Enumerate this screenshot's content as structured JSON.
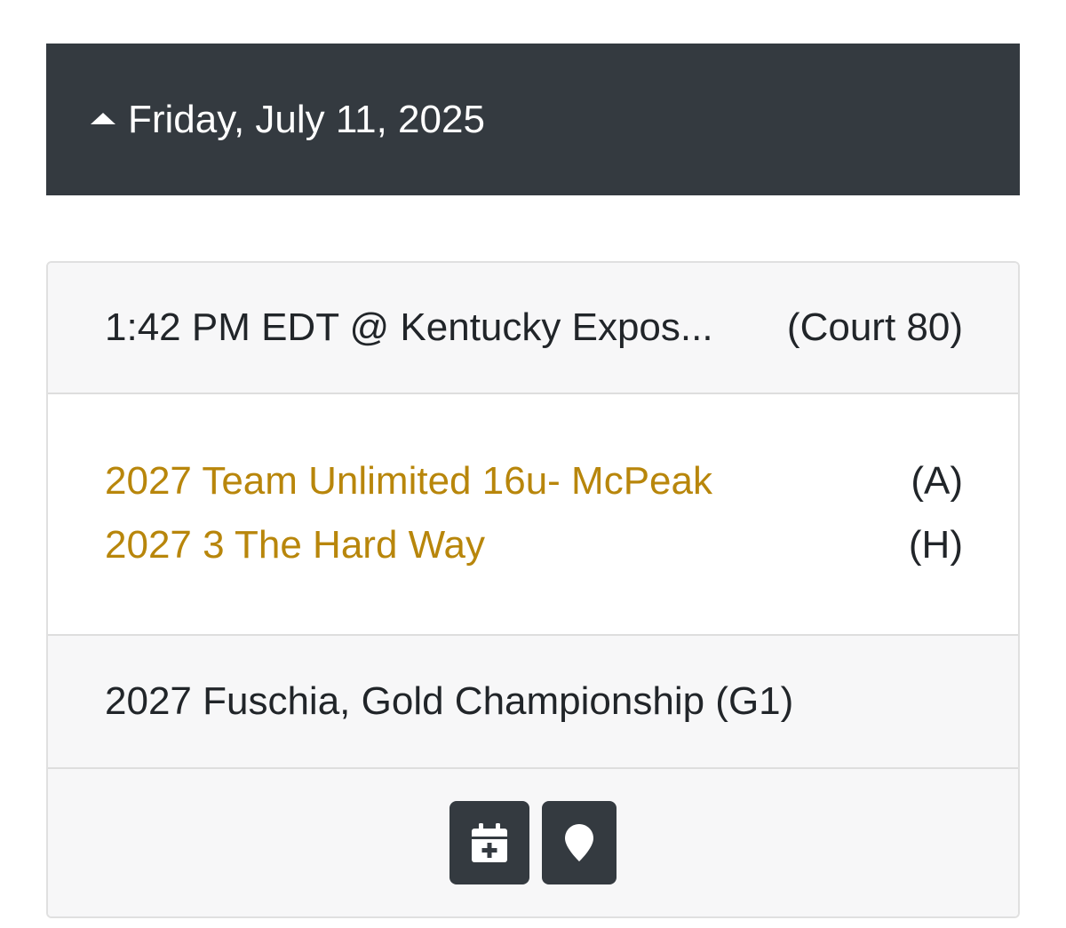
{
  "day_header": {
    "title": "Friday, July 11, 2025",
    "toggle_icon": "caret-up-icon"
  },
  "game": {
    "when": "1:42 PM EDT @ Kentucky Expos...",
    "court": "(Court 80)",
    "teams": [
      {
        "name": "2027 Team Unlimited 16u- McPeak",
        "side": "(A)"
      },
      {
        "name": "2027 3 The Hard Way",
        "side": "(H)"
      }
    ],
    "division": "2027 Fuschia, Gold Championship (G1)",
    "actions": [
      {
        "icon": "calendar-plus-icon"
      },
      {
        "icon": "map-marker-icon"
      }
    ]
  },
  "colors": {
    "header_bg": "#343a40",
    "team_link": "#b8860b",
    "row_bg": "#f7f7f8",
    "button_bg": "#343a40"
  }
}
